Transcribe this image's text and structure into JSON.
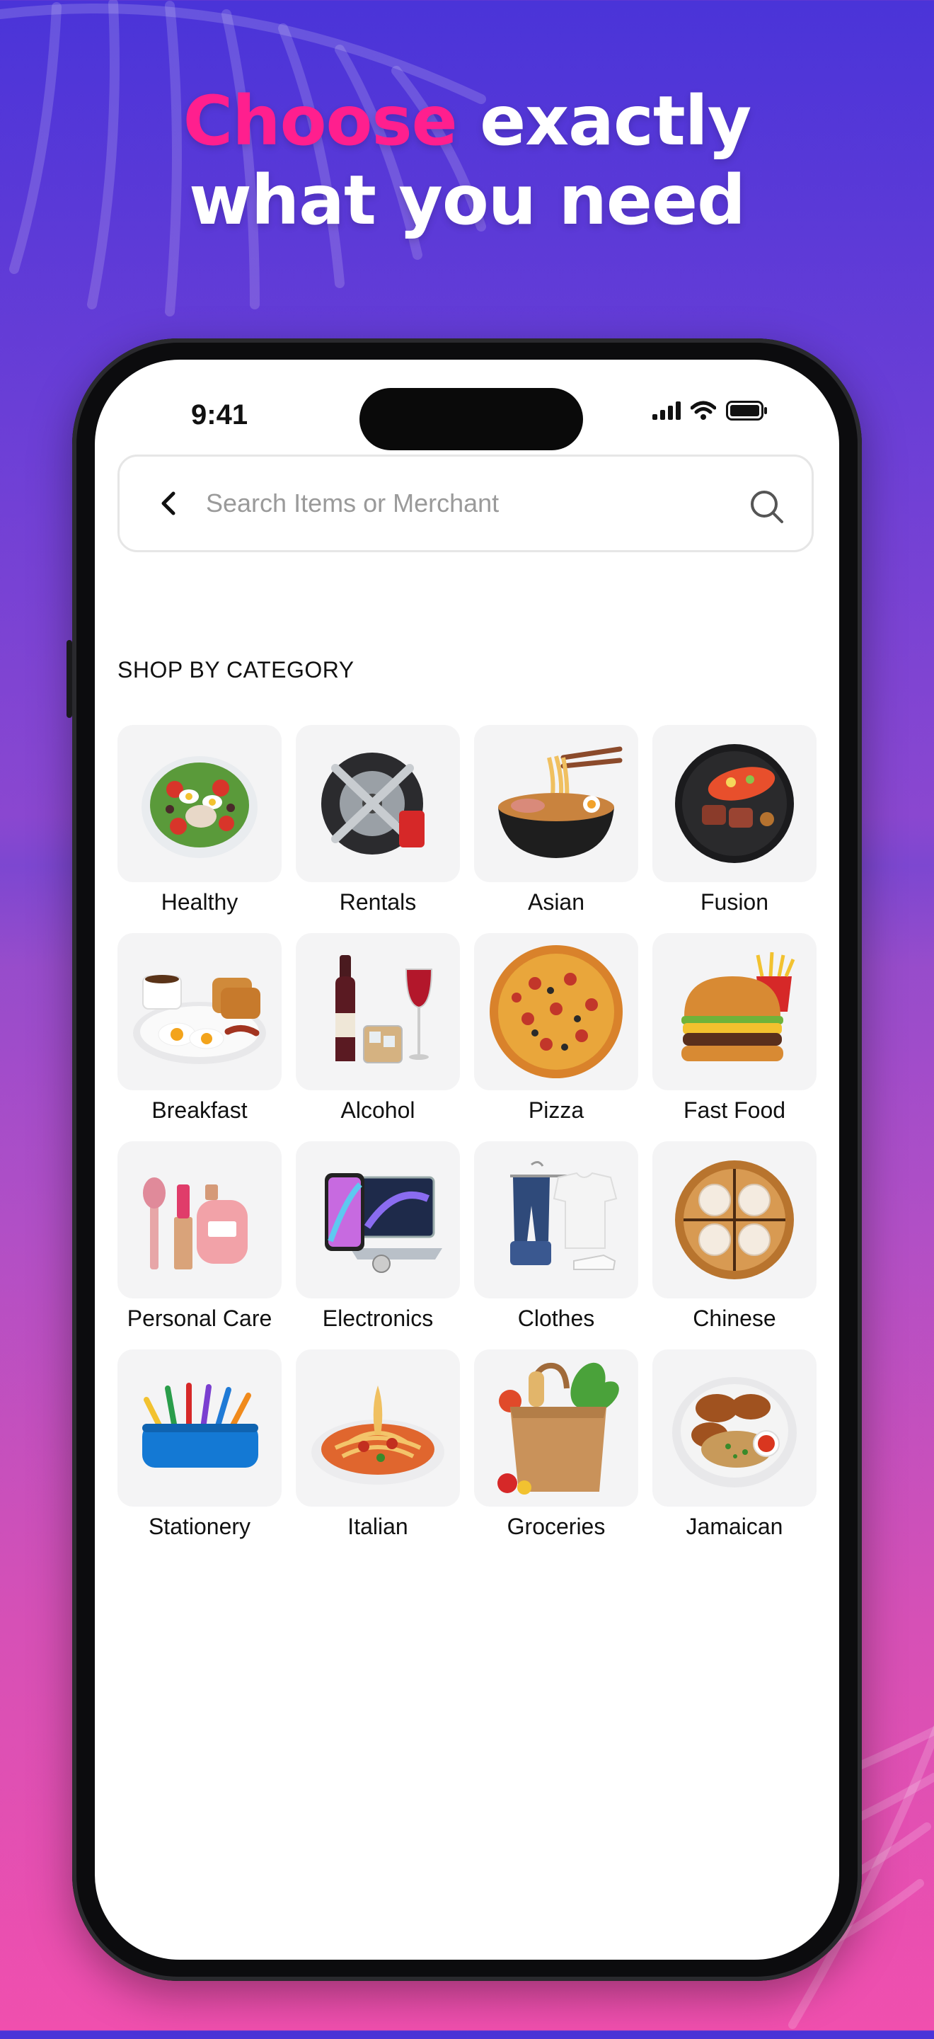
{
  "headline": {
    "accent": "Choose",
    "rest_line1": " exactly",
    "line2": "what you need"
  },
  "status_bar": {
    "time": "9:41"
  },
  "search": {
    "placeholder": "Search Items or Merchant"
  },
  "section_title": "SHOP BY CATEGORY",
  "categories": [
    {
      "label": "Healthy",
      "icon": "salad-icon"
    },
    {
      "label": "Rentals",
      "icon": "tire-tools-icon"
    },
    {
      "label": "Asian",
      "icon": "ramen-icon"
    },
    {
      "label": "Fusion",
      "icon": "fusion-plate-icon"
    },
    {
      "label": "Breakfast",
      "icon": "breakfast-icon"
    },
    {
      "label": "Alcohol",
      "icon": "wine-icon"
    },
    {
      "label": "Pizza",
      "icon": "pizza-icon"
    },
    {
      "label": "Fast Food",
      "icon": "burger-icon"
    },
    {
      "label": "Personal Care",
      "icon": "cosmetics-icon"
    },
    {
      "label": "Electronics",
      "icon": "devices-icon"
    },
    {
      "label": "Clothes",
      "icon": "clothes-icon"
    },
    {
      "label": "Chinese",
      "icon": "dumplings-icon"
    },
    {
      "label": "Stationery",
      "icon": "pencil-case-icon"
    },
    {
      "label": "Italian",
      "icon": "spaghetti-icon"
    },
    {
      "label": "Groceries",
      "icon": "grocery-bag-icon"
    },
    {
      "label": "Jamaican",
      "icon": "jerk-chicken-icon"
    }
  ],
  "colors": {
    "accent": "#ff1f8e",
    "tile_bg": "#f4f4f5",
    "bg_top": "#4a34d8",
    "bg_bottom": "#f04fae"
  }
}
